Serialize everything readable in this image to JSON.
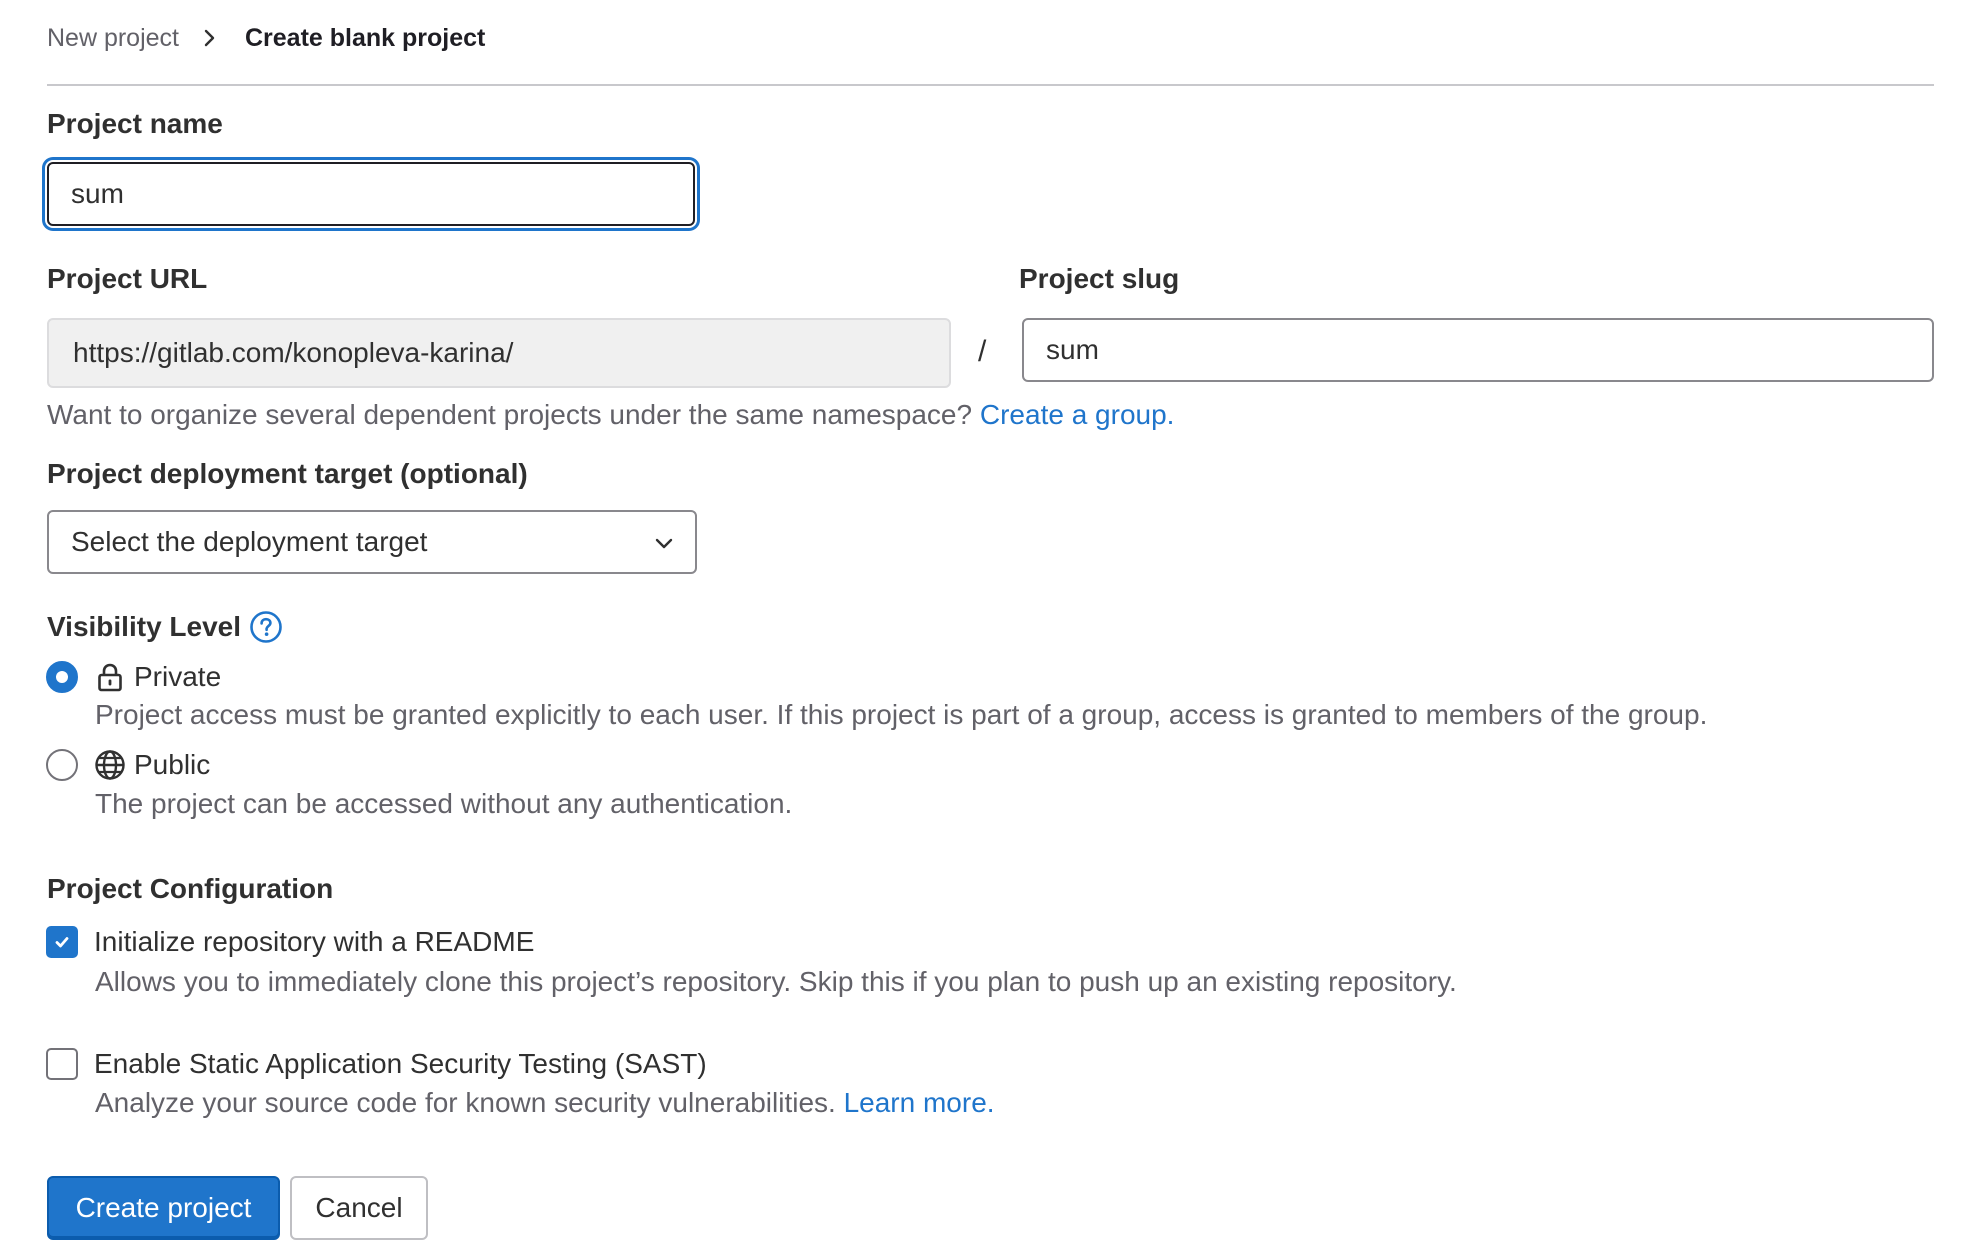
{
  "breadcrumb": {
    "parent": "New project",
    "current": "Create blank project"
  },
  "project_name": {
    "label": "Project name",
    "value": "sum"
  },
  "project_url": {
    "label": "Project URL",
    "value": "https://gitlab.com/konopleva-karina/",
    "separator": "/"
  },
  "project_slug": {
    "label": "Project slug",
    "value": "sum"
  },
  "group_help": {
    "text": "Want to organize several dependent projects under the same namespace?",
    "link": "Create a group."
  },
  "deployment": {
    "label": "Project deployment target (optional)",
    "selected": "Select the deployment target"
  },
  "visibility": {
    "label": "Visibility Level",
    "options": [
      {
        "label": "Private",
        "icon": "lock-icon",
        "checked": true,
        "description": "Project access must be granted explicitly to each user. If this project is part of a group, access is granted to members of the group."
      },
      {
        "label": "Public",
        "icon": "globe-icon",
        "checked": false,
        "description": "The project can be accessed without any authentication."
      }
    ]
  },
  "configuration": {
    "label": "Project Configuration",
    "readme": {
      "label": "Initialize repository with a README",
      "checked": true,
      "description": "Allows you to immediately clone this project’s repository. Skip this if you plan to push up an existing repository."
    },
    "sast": {
      "label": "Enable Static Application Security Testing (SAST)",
      "checked": false,
      "description": "Analyze your source code for known security vulnerabilities.",
      "link": "Learn more."
    }
  },
  "actions": {
    "create": "Create project",
    "cancel": "Cancel"
  },
  "colors": {
    "accent": "#1f75cb",
    "text": "#303030",
    "muted": "#626168"
  }
}
